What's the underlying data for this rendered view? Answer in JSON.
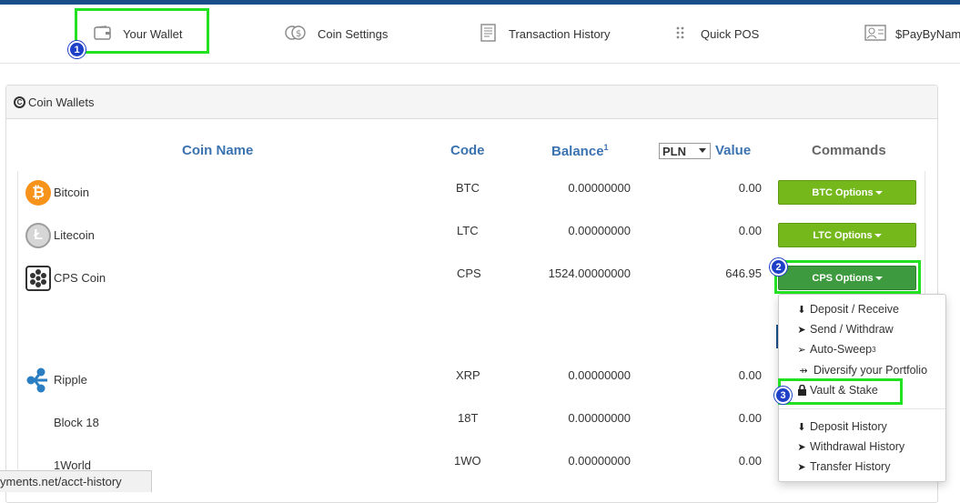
{
  "nav": {
    "items": [
      {
        "label": "Your Wallet"
      },
      {
        "label": "Coin Settings"
      },
      {
        "label": "Transaction History"
      },
      {
        "label": "Quick POS"
      },
      {
        "label": "$PayByName"
      }
    ]
  },
  "panel": {
    "title": "Coin Wallets"
  },
  "table": {
    "headers": {
      "coin_name": "Coin Name",
      "code": "Code",
      "balance": "Balance",
      "balance_sup": "1",
      "value": "Value",
      "commands": "Commands"
    },
    "currency": "PLN",
    "rows": [
      {
        "name": "Bitcoin",
        "code": "BTC",
        "balance": "0.00000000",
        "value": "0.00",
        "button": "BTC Options"
      },
      {
        "name": "Litecoin",
        "code": "LTC",
        "balance": "0.00000000",
        "value": "0.00",
        "button": "LTC Options"
      },
      {
        "name": "CPS Coin",
        "code": "CPS",
        "balance": "1524.00000000",
        "value": "646.95",
        "button": "CPS Options"
      },
      {
        "name": "Ripple",
        "code": "XRP",
        "balance": "0.00000000",
        "value": "0.00"
      },
      {
        "name": "Block 18",
        "code": "18T",
        "balance": "0.00000000",
        "value": "0.00"
      },
      {
        "name": "1World",
        "code": "1WO",
        "balance": "0.00000000",
        "value": "0.00"
      }
    ]
  },
  "dropdown": {
    "items": [
      {
        "label": "Deposit / Receive"
      },
      {
        "label": "Send / Withdraw"
      },
      {
        "label": "Auto-Sweep",
        "sup": "3"
      },
      {
        "label": "Diversify your Portfolio"
      },
      {
        "label": "Vault & Stake"
      },
      {
        "label": "Deposit History"
      },
      {
        "label": "Withdrawal History"
      },
      {
        "label": "Transfer History"
      }
    ]
  },
  "annotations": [
    "1",
    "2",
    "3"
  ],
  "status_url": "yments.net/acct-history",
  "colors": {
    "accent_blue": "#3b73b0",
    "button_green": "#74b81c",
    "button_active": "#3e9a3e",
    "highlight": "#22e022",
    "badge": "#1e40c8"
  }
}
